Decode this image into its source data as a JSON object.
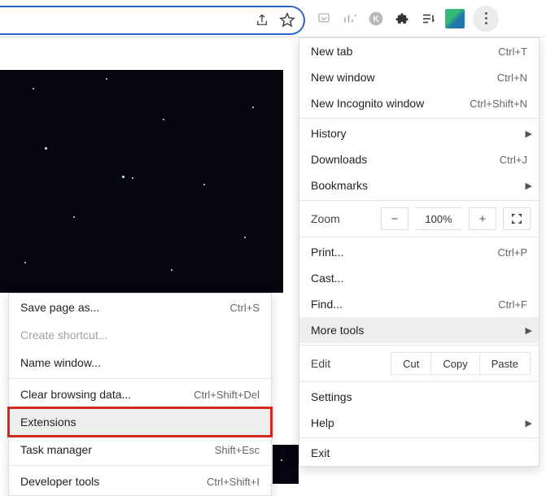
{
  "toolbar": {
    "omnibox_value": "",
    "share_icon": "share-icon",
    "star_icon": "bookmark-star-icon"
  },
  "main_menu": {
    "new_tab": {
      "label": "New tab",
      "shortcut": "Ctrl+T"
    },
    "new_window": {
      "label": "New window",
      "shortcut": "Ctrl+N"
    },
    "new_incognito": {
      "label": "New Incognito window",
      "shortcut": "Ctrl+Shift+N"
    },
    "history": {
      "label": "History"
    },
    "downloads": {
      "label": "Downloads",
      "shortcut": "Ctrl+J"
    },
    "bookmarks": {
      "label": "Bookmarks"
    },
    "zoom": {
      "label": "Zoom",
      "minus": "−",
      "value": "100%",
      "plus": "+"
    },
    "print": {
      "label": "Print...",
      "shortcut": "Ctrl+P"
    },
    "cast": {
      "label": "Cast..."
    },
    "find": {
      "label": "Find...",
      "shortcut": "Ctrl+F"
    },
    "more_tools": {
      "label": "More tools"
    },
    "edit": {
      "label": "Edit",
      "cut": "Cut",
      "copy": "Copy",
      "paste": "Paste"
    },
    "settings": {
      "label": "Settings"
    },
    "help": {
      "label": "Help"
    },
    "exit": {
      "label": "Exit"
    }
  },
  "sub_menu": {
    "save_page": {
      "label": "Save page as...",
      "shortcut": "Ctrl+S"
    },
    "create_shortcut": {
      "label": "Create shortcut..."
    },
    "name_window": {
      "label": "Name window..."
    },
    "clear_data": {
      "label": "Clear browsing data...",
      "shortcut": "Ctrl+Shift+Del"
    },
    "extensions": {
      "label": "Extensions"
    },
    "task_manager": {
      "label": "Task manager",
      "shortcut": "Shift+Esc"
    },
    "dev_tools": {
      "label": "Developer tools",
      "shortcut": "Ctrl+Shift+I"
    }
  }
}
